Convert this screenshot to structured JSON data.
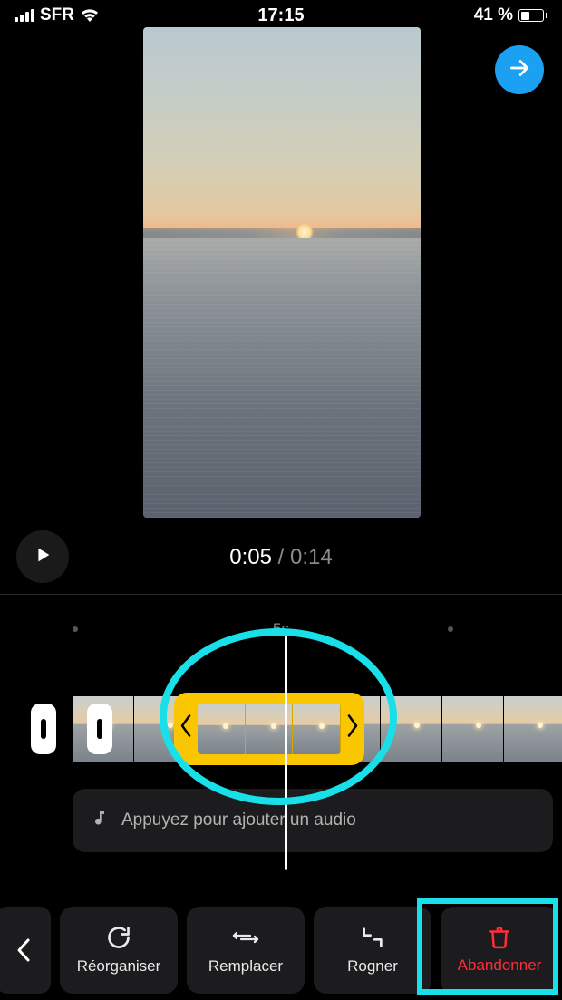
{
  "status": {
    "carrier": "SFR",
    "time": "17:15",
    "battery_text": "41 %",
    "battery_pct": 41
  },
  "playback": {
    "current": "0:05",
    "separator": " / ",
    "total": "0:14"
  },
  "ruler": {
    "label": "5s"
  },
  "audio": {
    "prompt": "Appuyez pour ajouter un audio"
  },
  "toolbar": {
    "back_icon": "chevron-left",
    "buttons": [
      {
        "label": "Réorganiser"
      },
      {
        "label": "Remplacer"
      },
      {
        "label": "Rogner"
      },
      {
        "label": "Abandonner"
      }
    ]
  },
  "preview": {
    "sun_left_pct": 55,
    "sun_top_pct": 40
  }
}
